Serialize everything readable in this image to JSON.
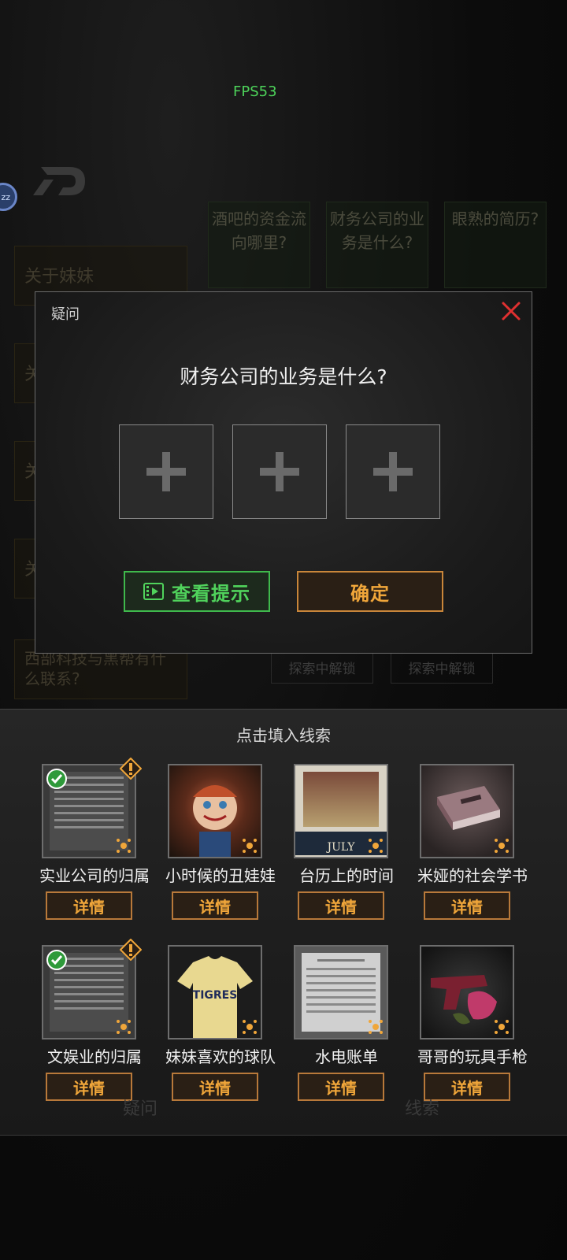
{
  "hud": {
    "fps": "FPS53",
    "avatar_text": "zz"
  },
  "background": {
    "question_cards": [
      "酒吧的资金流向哪里?",
      "财务公司的业务是什么?",
      "眼熟的简历?"
    ],
    "side_tabs": [
      "关于妹妹",
      "关",
      "关",
      "关",
      "西部科技与黑帮有什么联系?"
    ],
    "unlock_labels": [
      "探索中解锁",
      "探索中解锁"
    ],
    "bottom_tabs": [
      "疑问",
      "线索"
    ]
  },
  "modal": {
    "title": "疑问",
    "question": "财务公司的业务是什么?",
    "hint_button": "查看提示",
    "confirm_button": "确定",
    "slot_count": 3
  },
  "clue_panel": {
    "title": "点击填入线索",
    "detail_label": "详情",
    "clues": [
      {
        "name": "实业公司的归属",
        "checked": true,
        "warning": true,
        "thumb": "document"
      },
      {
        "name": "小时候的丑娃娃",
        "checked": false,
        "warning": false,
        "thumb": "doll"
      },
      {
        "name": "台历上的时间",
        "checked": false,
        "warning": false,
        "thumb": "calendar",
        "thumb_text": "JULY"
      },
      {
        "name": "米娅的社会学书",
        "checked": false,
        "warning": false,
        "thumb": "book"
      },
      {
        "name": "文娱业的归属",
        "checked": true,
        "warning": true,
        "thumb": "document"
      },
      {
        "name": "妹妹喜欢的球队",
        "checked": false,
        "warning": false,
        "thumb": "jersey",
        "thumb_text": "TIGRES"
      },
      {
        "name": "水电账单",
        "checked": false,
        "warning": false,
        "thumb": "bill"
      },
      {
        "name": "哥哥的玩具手枪",
        "checked": false,
        "warning": false,
        "thumb": "gun"
      }
    ]
  },
  "colors": {
    "accent_green": "#50d35c",
    "accent_orange": "#f0a63a",
    "close_red": "#e03030"
  }
}
